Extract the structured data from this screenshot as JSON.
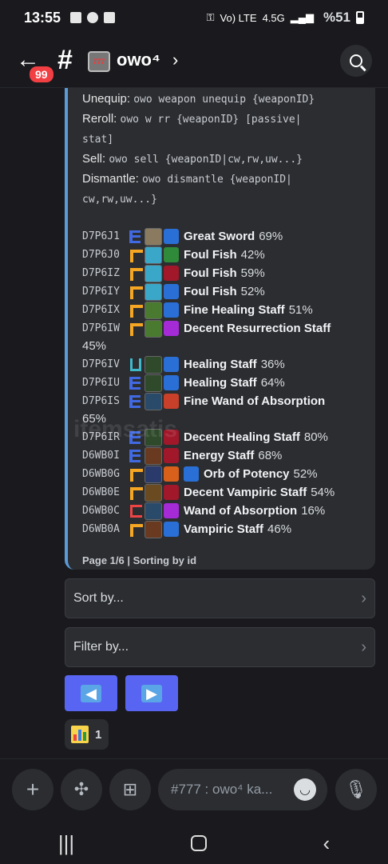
{
  "status_bar": {
    "time": "13:55",
    "network": "4.5G",
    "volte": "Vo) LTE",
    "battery_pct": "%51"
  },
  "header": {
    "unread_badge": "99",
    "channel_name": "owo⁴",
    "slot_text": "777"
  },
  "embed": {
    "commands": [
      {
        "label": "Unequip:",
        "code": "owo weapon unequip {weaponID}"
      },
      {
        "label": "Reroll:",
        "code": "owo w rr {weaponID} [passive|",
        "code2": "stat]"
      },
      {
        "label": "Sell:",
        "code": "owo sell {weaponID|cw,rw,uw...}"
      },
      {
        "label": "Dismantle:",
        "code": "owo dismantle {weaponID|",
        "code2": "cw,rw,uw...}"
      }
    ],
    "weapons": [
      {
        "id": "D7P6J1",
        "rarity": "E",
        "weapon_color": "#8a7a60",
        "passive_color": "#2a6fd6",
        "name": "Great Sword",
        "pct": "69%"
      },
      {
        "id": "D7P6J0",
        "rarity": "L",
        "weapon_color": "#3aa6c8",
        "passive_color": "#2f8a3a",
        "name": "Foul Fish",
        "pct": "42%"
      },
      {
        "id": "D7P6IZ",
        "rarity": "L",
        "weapon_color": "#3aa6c8",
        "passive_color": "#a0182a",
        "name": "Foul Fish",
        "pct": "59%"
      },
      {
        "id": "D7P6IY",
        "rarity": "L",
        "weapon_color": "#3aa6c8",
        "passive_color": "#2a6fd6",
        "name": "Foul Fish",
        "pct": "52%"
      },
      {
        "id": "D7P6IX",
        "rarity": "L",
        "weapon_color": "#4a7a30",
        "passive_color": "#2a6fd6",
        "name": "Fine Healing Staff",
        "pct": "51%"
      },
      {
        "id": "D7P6IW",
        "rarity": "L",
        "weapon_color": "#4a7a30",
        "passive_color": "#a42bd6",
        "name": "Decent Resurrection Staff",
        "pct": "45%"
      },
      {
        "id": "D7P6IV",
        "rarity": "U",
        "weapon_color": "#2e4a2a",
        "passive_color": "#2a6fd6",
        "name": "Healing Staff",
        "pct": "36%"
      },
      {
        "id": "D7P6IU",
        "rarity": "E",
        "weapon_color": "#2e4a2a",
        "passive_color": "#2a6fd6",
        "name": "Healing Staff",
        "pct": "64%"
      },
      {
        "id": "D7P6IS",
        "rarity": "E",
        "weapon_color": "#2a4a6a",
        "passive_color": "#c8402a",
        "name": "Fine Wand of Absorption",
        "pct": "65%"
      },
      {
        "id": "D7P6IR",
        "rarity": "E",
        "weapon_color": "#2e4a2a",
        "passive_color": "#a0182a",
        "name": "Decent Healing Staff",
        "pct": "80%"
      },
      {
        "id": "D6WB0I",
        "rarity": "E",
        "weapon_color": "#6a3a20",
        "passive_color": "#a0182a",
        "name": "Energy Staff",
        "pct": "68%"
      },
      {
        "id": "D6WB0G",
        "rarity": "L",
        "weapon_color": "#2a3a6a",
        "passive_color": "#d8601a",
        "name": "Orb of Potency",
        "pct": "52%",
        "extra_color": "#2a6fd6"
      },
      {
        "id": "D6WB0E",
        "rarity": "L",
        "weapon_color": "#6a4a20",
        "passive_color": "#a0182a",
        "name": "Decent Vampiric Staff",
        "pct": "54%"
      },
      {
        "id": "D6WB0C",
        "rarity": "C",
        "weapon_color": "#2a4a6a",
        "passive_color": "#a42bd6",
        "name": "Wand of Absorption",
        "pct": "16%"
      },
      {
        "id": "D6WB0A",
        "rarity": "L",
        "weapon_color": "#6a3a20",
        "passive_color": "#2a6fd6",
        "name": "Vampiric Staff",
        "pct": "46%"
      }
    ],
    "footer": "Page 1/6 | Sorting by id",
    "watermark": "itemsatis"
  },
  "controls": {
    "sort_label": "Sort by...",
    "filter_label": "Filter by...",
    "prev_glyph": "🡄",
    "next_glyph": "🡆"
  },
  "reaction": {
    "count": "1"
  },
  "composer": {
    "placeholder": "#777 : owo⁴ ka..."
  }
}
